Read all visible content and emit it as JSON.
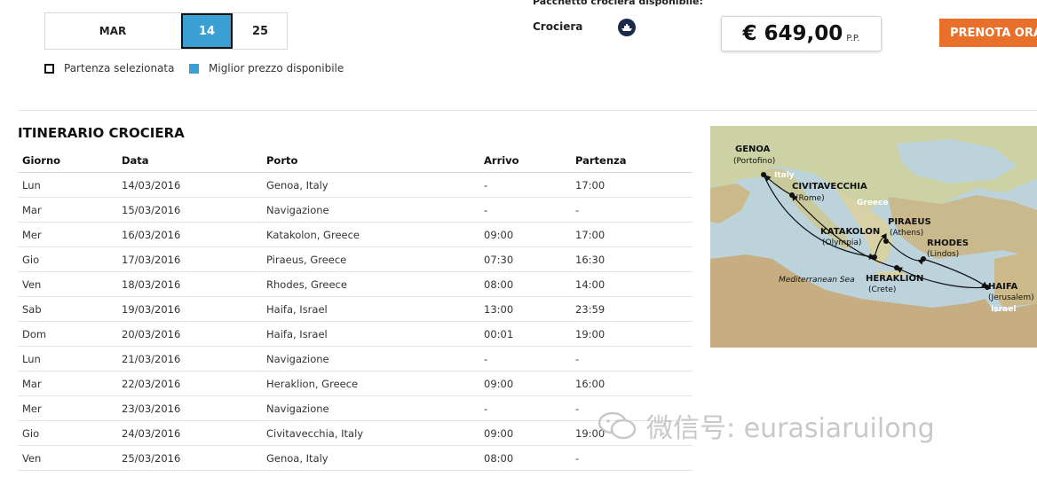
{
  "date_selector": {
    "month": "MAR",
    "day_selected": "14",
    "day_other": "25"
  },
  "legend": {
    "selected": "Partenza selezionata",
    "best_price": "Miglior prezzo disponibile"
  },
  "package": {
    "title": "Pacchetto crociera disponibile:",
    "label": "Crociera",
    "icon": "ship-icon",
    "price": "€  649,00",
    "price_unit": "P.P.",
    "book_button": "PRENOTA ORA"
  },
  "colors": {
    "accent_blue": "#3aa0d4",
    "book_orange": "#e8702a"
  },
  "itinerary": {
    "title": "ITINERARIO CROCIERA",
    "headers": [
      "Giorno",
      "Data",
      "Porto",
      "Arrivo",
      "Partenza"
    ],
    "rows": [
      [
        "Lun",
        "14/03/2016",
        "Genoa, Italy",
        "-",
        "17:00"
      ],
      [
        "Mar",
        "15/03/2016",
        "Navigazione",
        "-",
        "-"
      ],
      [
        "Mer",
        "16/03/2016",
        "Katakolon, Greece",
        "09:00",
        "17:00"
      ],
      [
        "Gio",
        "17/03/2016",
        "Piraeus, Greece",
        "07:30",
        "16:30"
      ],
      [
        "Ven",
        "18/03/2016",
        "Rhodes, Greece",
        "08:00",
        "14:00"
      ],
      [
        "Sab",
        "19/03/2016",
        "Haifa, Israel",
        "13:00",
        "23:59"
      ],
      [
        "Dom",
        "20/03/2016",
        "Haifa, Israel",
        "00:01",
        "19:00"
      ],
      [
        "Lun",
        "21/03/2016",
        "Navigazione",
        "-",
        "-"
      ],
      [
        "Mar",
        "22/03/2016",
        "Heraklion, Greece",
        "09:00",
        "16:00"
      ],
      [
        "Mer",
        "23/03/2016",
        "Navigazione",
        "-",
        "-"
      ],
      [
        "Gio",
        "24/03/2016",
        "Civitavecchia, Italy",
        "09:00",
        "19:00"
      ],
      [
        "Ven",
        "25/03/2016",
        "Genoa, Italy",
        "08:00",
        "-"
      ]
    ]
  },
  "map": {
    "ports": [
      {
        "name": "GENOA",
        "sub": "(Portofino)"
      },
      {
        "name": "CIVITAVECCHIA",
        "sub": "(Rome)"
      },
      {
        "name": "KATAKOLON",
        "sub": "(Olympia)"
      },
      {
        "name": "PIRAEUS",
        "sub": "(Athens)"
      },
      {
        "name": "RHODES",
        "sub": "(Lindos)"
      },
      {
        "name": "HERAKLION",
        "sub": "(Crete)"
      },
      {
        "name": "HAIFA",
        "sub": "(Jerusalem)"
      }
    ],
    "countries": [
      "Italy",
      "Greece",
      "Israel"
    ],
    "sea": "Mediterranean Sea"
  },
  "watermark": {
    "text": "微信号: eurasiaruilong",
    "icon": "wechat-icon"
  }
}
